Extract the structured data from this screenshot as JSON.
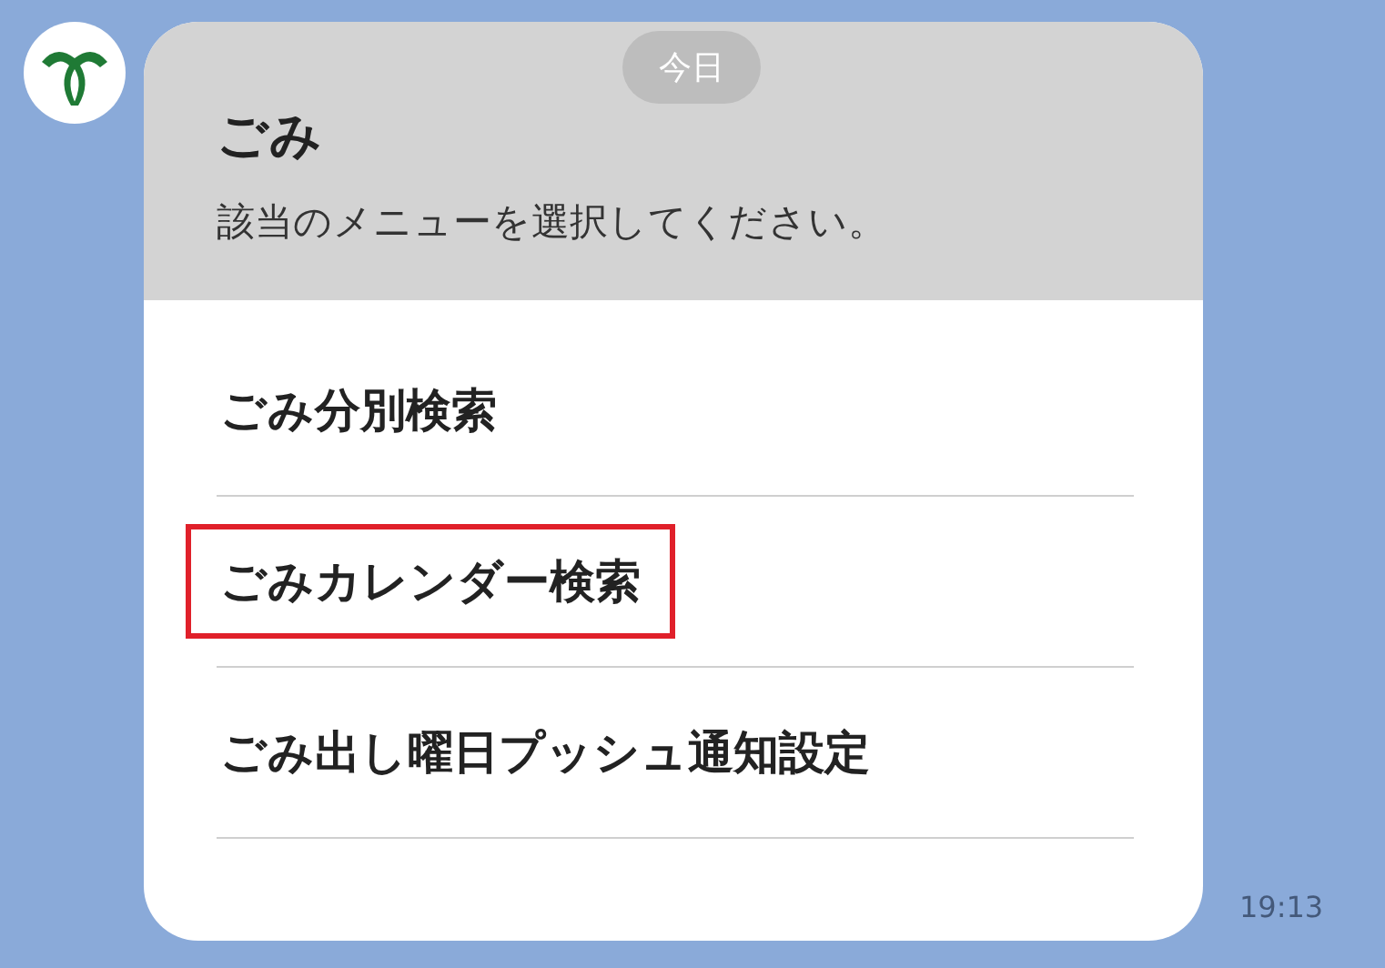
{
  "date_pill": "今日",
  "card": {
    "title": "ごみ",
    "subtitle": "該当のメニューを選択してください。"
  },
  "menu_items": [
    {
      "label": "ごみ分別検索",
      "highlighted": false
    },
    {
      "label": "ごみカレンダー検索",
      "highlighted": true
    },
    {
      "label": "ごみ出し曜日プッシュ通知設定",
      "highlighted": false
    }
  ],
  "time": "19:13"
}
